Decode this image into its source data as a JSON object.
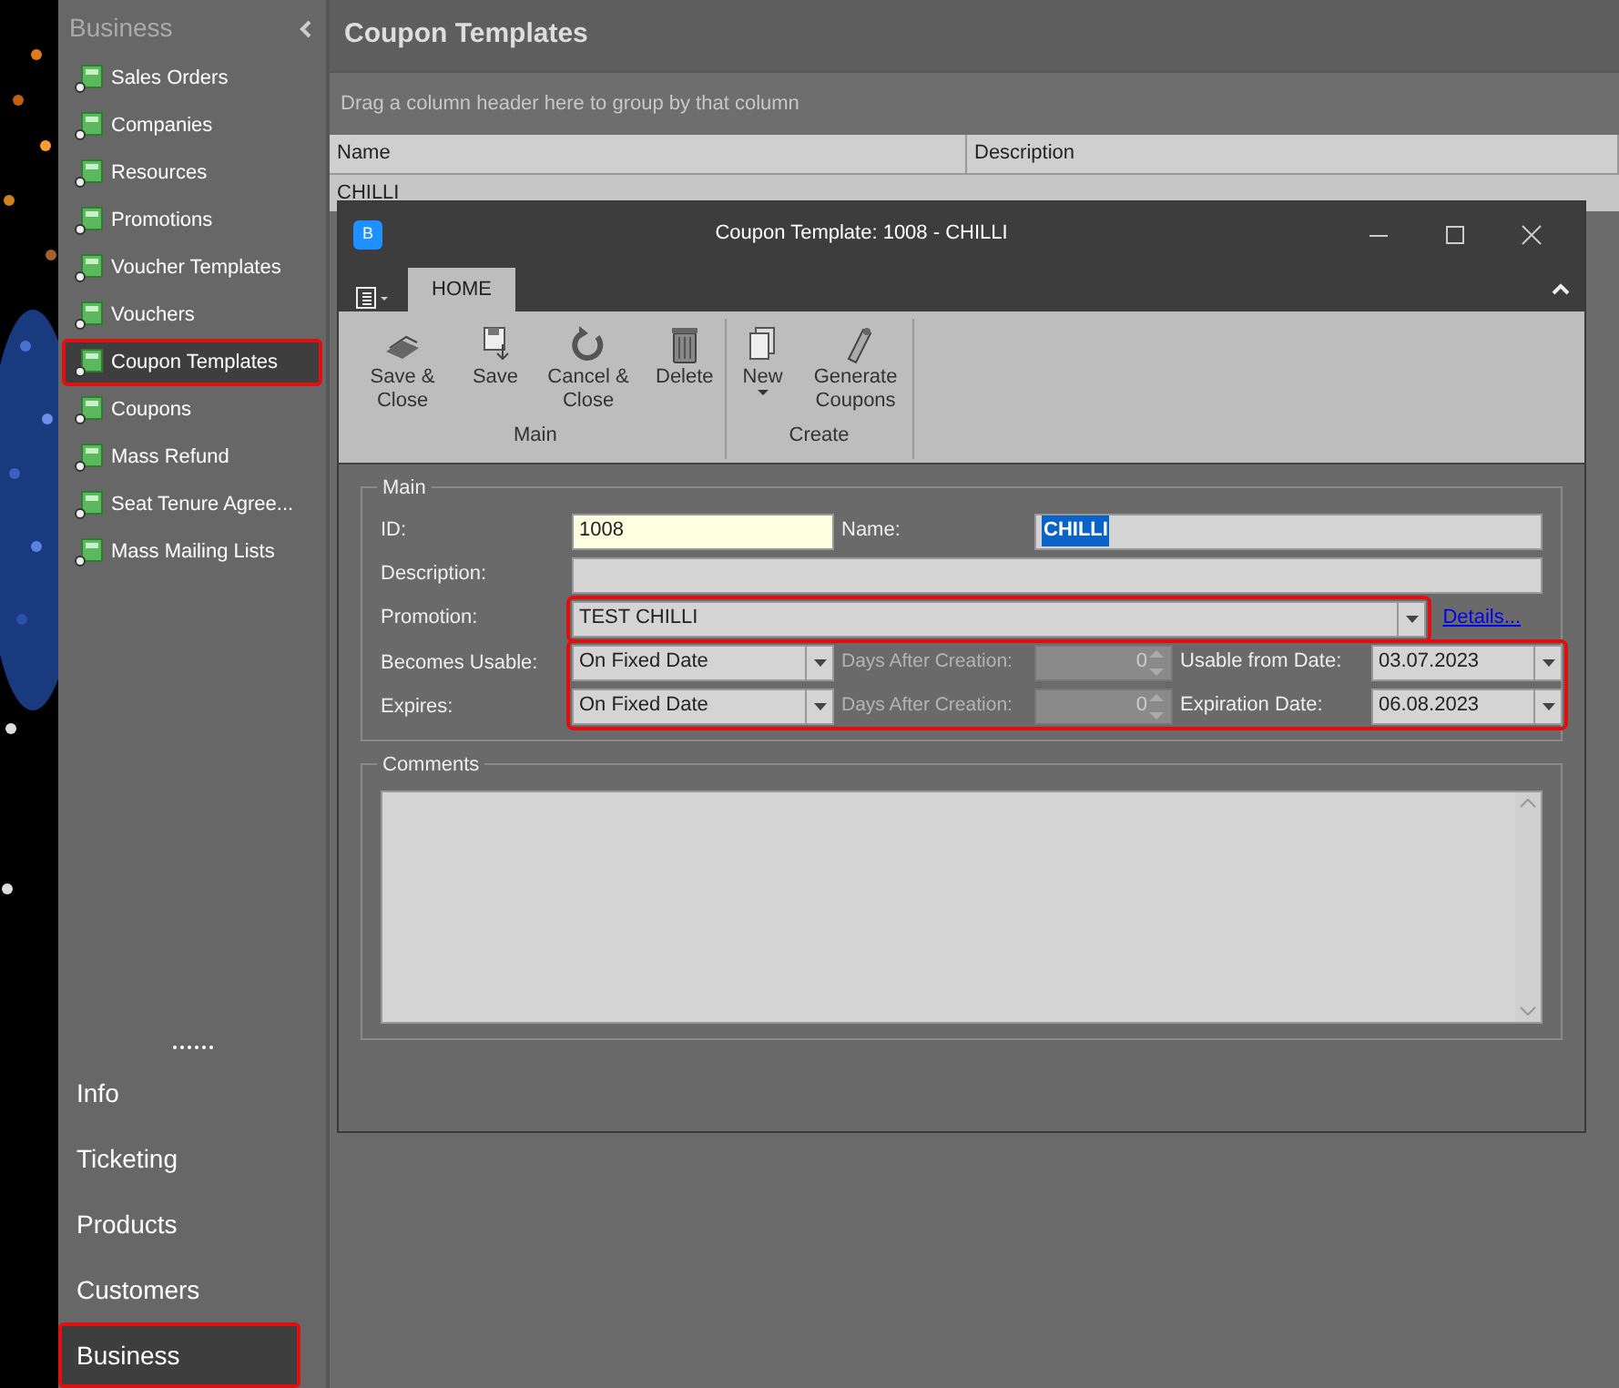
{
  "sidebar": {
    "title": "Business",
    "items": [
      {
        "label": "Sales Orders",
        "selected": false
      },
      {
        "label": "Companies",
        "selected": false
      },
      {
        "label": "Resources",
        "selected": false
      },
      {
        "label": "Promotions",
        "selected": false
      },
      {
        "label": "Voucher Templates",
        "selected": false
      },
      {
        "label": "Vouchers",
        "selected": false
      },
      {
        "label": "Coupon Templates",
        "selected": true
      },
      {
        "label": "Coupons",
        "selected": false
      },
      {
        "label": "Mass Refund",
        "selected": false
      },
      {
        "label": "Seat Tenure Agree...",
        "selected": false
      },
      {
        "label": "Mass Mailing Lists",
        "selected": false
      }
    ],
    "sections": [
      {
        "label": "Info",
        "selected": false
      },
      {
        "label": "Ticketing",
        "selected": false
      },
      {
        "label": "Products",
        "selected": false
      },
      {
        "label": "Customers",
        "selected": false
      },
      {
        "label": "Business",
        "selected": true
      }
    ]
  },
  "page": {
    "title": "Coupon Templates",
    "group_hint": "Drag a column header here to group by that column",
    "columns": [
      "Name",
      "Description"
    ],
    "rows": [
      {
        "name": "CHILLI"
      }
    ]
  },
  "dialog": {
    "title": "Coupon Template: 1008 - CHILLI",
    "app_badge": "B",
    "tabs": [
      {
        "label": "HOME",
        "selected": true
      }
    ],
    "ribbon_groups": [
      {
        "label": "Main",
        "buttons": [
          {
            "label": "Save & Close",
            "kind": "save-close"
          },
          {
            "label": "Save",
            "kind": "save"
          },
          {
            "label": "Cancel & Close",
            "kind": "cancel"
          },
          {
            "label": "Delete",
            "kind": "delete"
          }
        ]
      },
      {
        "label": "Create",
        "buttons": [
          {
            "label": "New",
            "kind": "new",
            "dropdown": true
          },
          {
            "label": "Generate Coupons",
            "kind": "generate"
          }
        ]
      }
    ],
    "main_group": {
      "title": "Main",
      "id": {
        "label": "ID:",
        "value": "1008",
        "required": true
      },
      "name": {
        "label": "Name:",
        "value": "CHILLI",
        "text_selected": true
      },
      "description": {
        "label": "Description:"
      },
      "promotion": {
        "label": "Promotion:",
        "value": "TEST CHILLI",
        "highlighted": true,
        "link": "Details..."
      },
      "schedule": {
        "highlighted": true,
        "rows": [
          {
            "label": "Becomes Usable:",
            "mode": "On Fixed Date",
            "days_label": "Days After Creation:",
            "days": "0",
            "disabled": true,
            "date_label": "Usable from Date:",
            "date": "03.07.2023"
          },
          {
            "label": "Expires:",
            "mode": "On Fixed Date",
            "days_label": "Days After Creation:",
            "days": "0",
            "disabled": true,
            "date_label": "Expiration Date:",
            "date": "06.08.2023"
          }
        ]
      }
    },
    "comments_group": {
      "title": "Comments"
    }
  }
}
